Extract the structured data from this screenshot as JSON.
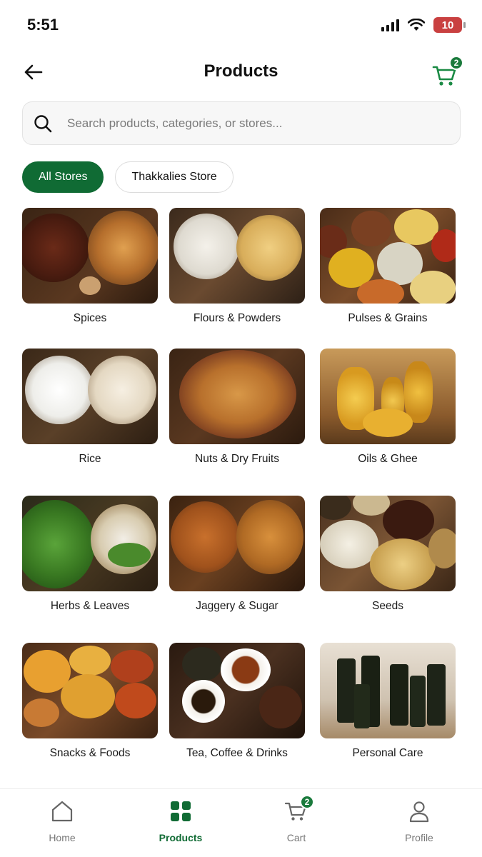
{
  "status_bar": {
    "time": "5:51",
    "battery": "10"
  },
  "header": {
    "title": "Products",
    "cart_count": "2"
  },
  "search": {
    "placeholder": "Search products, categories, or stores..."
  },
  "filters": [
    {
      "label": "All Stores",
      "active": true
    },
    {
      "label": "Thakkalies Store",
      "active": false
    }
  ],
  "categories": [
    {
      "label": "Spices"
    },
    {
      "label": "Flours & Powders"
    },
    {
      "label": "Pulses & Grains"
    },
    {
      "label": "Rice"
    },
    {
      "label": "Nuts & Dry Fruits"
    },
    {
      "label": "Oils & Ghee"
    },
    {
      "label": "Herbs & Leaves"
    },
    {
      "label": "Jaggery & Sugar"
    },
    {
      "label": "Seeds"
    },
    {
      "label": "Snacks & Foods"
    },
    {
      "label": "Tea, Coffee & Drinks"
    },
    {
      "label": "Personal Care"
    }
  ],
  "bottom_nav": {
    "items": [
      {
        "label": "Home",
        "icon": "home-icon"
      },
      {
        "label": "Products",
        "icon": "grid-icon",
        "active": true
      },
      {
        "label": "Cart",
        "icon": "cart-icon",
        "badge": "2"
      },
      {
        "label": "Profile",
        "icon": "profile-icon"
      }
    ]
  },
  "colors": {
    "accent": "#106b34",
    "battery_low": "#c94040"
  }
}
